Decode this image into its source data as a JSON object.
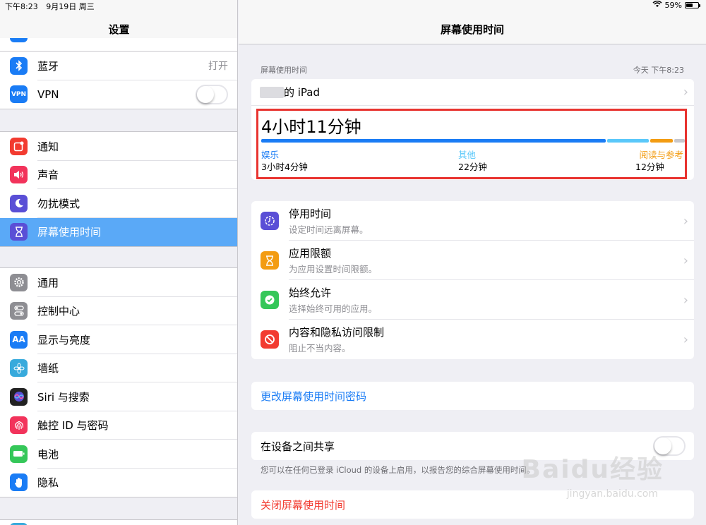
{
  "status": {
    "time": "下午8:23",
    "date": "9月19日 周三",
    "battery": "59%",
    "battery_fraction": 0.59
  },
  "sidebar": {
    "title": "设置",
    "group1": [
      {
        "label": "蓝牙",
        "value": "打开",
        "icon": "bluetooth-icon",
        "color": "#1a7cf5"
      },
      {
        "label": "VPN",
        "icon": "vpn-icon",
        "color": "#1a7cf5",
        "toggle": false
      }
    ],
    "group2": [
      {
        "label": "通知",
        "icon": "notifications-icon",
        "color": "#f23b30"
      },
      {
        "label": "声音",
        "icon": "sound-icon",
        "color": "#f2335b"
      },
      {
        "label": "勿扰模式",
        "icon": "moon-icon",
        "color": "#5a4fd6"
      },
      {
        "label": "屏幕使用时间",
        "icon": "hourglass-icon",
        "color": "#5a4fd6",
        "selected": true
      }
    ],
    "group3": [
      {
        "label": "通用",
        "icon": "gear-icon",
        "color": "#8e8e93"
      },
      {
        "label": "控制中心",
        "icon": "control-center-icon",
        "color": "#8e8e93"
      },
      {
        "label": "显示与亮度",
        "icon": "display-icon",
        "color": "#1a7cf5"
      },
      {
        "label": "墙纸",
        "icon": "wallpaper-icon",
        "color": "#37aadc"
      },
      {
        "label": "Siri 与搜索",
        "icon": "siri-icon",
        "color": "#222222"
      },
      {
        "label": "触控 ID 与密码",
        "icon": "fingerprint-icon",
        "color": "#f2335b"
      },
      {
        "label": "电池",
        "icon": "battery-icon",
        "color": "#35c759"
      },
      {
        "label": "隐私",
        "icon": "hand-icon",
        "color": "#1a7cf5"
      }
    ]
  },
  "main": {
    "title": "屏幕使用时间",
    "section_label": "屏幕使用时间",
    "section_time": "今天 下午8:23",
    "device_name": "的 iPad",
    "usage": {
      "total": "4小时11分钟",
      "categories": [
        {
          "name": "娱乐",
          "duration": "3小时4分钟",
          "color": "#1a7cf5"
        },
        {
          "name": "其他",
          "duration": "22分钟",
          "color": "#5ac8fa"
        },
        {
          "name": "阅读与参考",
          "duration": "12分钟",
          "color": "#f39c12"
        }
      ]
    },
    "options": [
      {
        "title": "停用时间",
        "subtitle": "设定时间远离屏幕。",
        "icon": "downtime-icon",
        "color": "#5a4fd6"
      },
      {
        "title": "应用限额",
        "subtitle": "为应用设置时间限额。",
        "icon": "hourglass-icon",
        "color": "#f39c12"
      },
      {
        "title": "始终允许",
        "subtitle": "选择始终可用的应用。",
        "icon": "checkmark-badge-icon",
        "color": "#35c759"
      },
      {
        "title": "内容和隐私访问限制",
        "subtitle": "阻止不当内容。",
        "icon": "no-entry-icon",
        "color": "#f23b30"
      }
    ],
    "change_passcode": "更改屏幕使用时间密码",
    "share_label": "在设备之间共享",
    "share_toggle": false,
    "share_note": "您可以在任何已登录 iCloud 的设备上启用，以报告您的综合屏幕使用时间。",
    "turn_off": "关闭屏幕使用时间"
  },
  "watermark": {
    "main": "Baidu经验",
    "sub": "jingyan.baidu.com"
  }
}
